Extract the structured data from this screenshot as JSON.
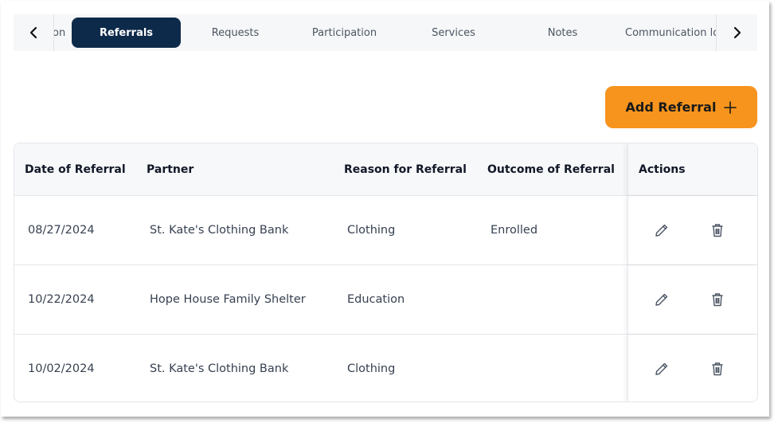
{
  "tabs": {
    "items": [
      {
        "label": "on"
      },
      {
        "label": "Referrals",
        "active": true
      },
      {
        "label": "Requests"
      },
      {
        "label": "Participation"
      },
      {
        "label": "Services"
      },
      {
        "label": "Notes"
      },
      {
        "label": "Communication log"
      }
    ],
    "prev_icon": "chevron-left-icon",
    "next_icon": "chevron-right-icon"
  },
  "add_button": {
    "label": "Add Referral",
    "icon": "plus-icon",
    "color": "#f7941d"
  },
  "table": {
    "columns": [
      "Date of Referral",
      "Partner",
      "Reason for Referral",
      "Outcome of Referral",
      "Actions"
    ],
    "rows": [
      {
        "date": "08/27/2024",
        "partner": "St. Kate's Clothing Bank",
        "reason": "Clothing",
        "outcome": "Enrolled"
      },
      {
        "date": "10/22/2024",
        "partner": "Hope House Family Shelter",
        "reason": "Education",
        "outcome": ""
      },
      {
        "date": "10/02/2024",
        "partner": "St. Kate's Clothing Bank",
        "reason": "Clothing",
        "outcome": ""
      }
    ],
    "row_actions": [
      "pencil-icon",
      "trash-icon"
    ]
  },
  "colors": {
    "active_tab": "#0e2a4a",
    "accent": "#f7941d"
  }
}
